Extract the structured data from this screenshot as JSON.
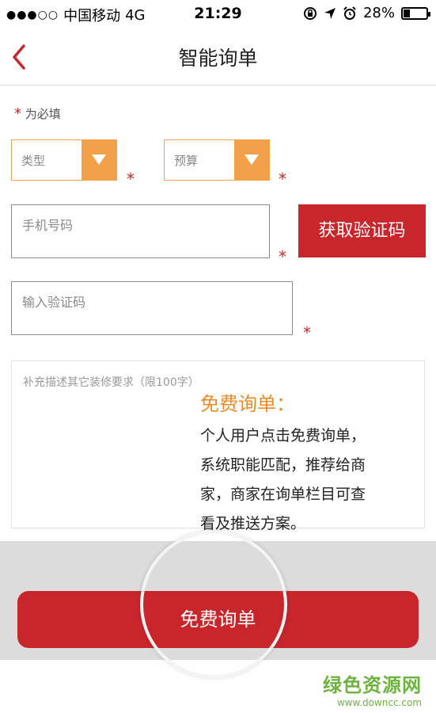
{
  "status_bar": {
    "carrier": "中国移动",
    "network": "4G",
    "time": "21:29",
    "battery": "28%",
    "battery_level": 0.28
  },
  "nav": {
    "back_icon": "chevron-left-icon",
    "title": "智能询单"
  },
  "form": {
    "required_note": "为必填",
    "required_mark": "*",
    "type_select": {
      "value": "类型",
      "icon": "triangle-down-icon"
    },
    "budget_select": {
      "value": "预算",
      "icon": "triangle-down-icon"
    },
    "phone_input": {
      "value": "",
      "placeholder": "手机号码"
    },
    "get_code_button": "获取验证码",
    "code_input": {
      "value": "",
      "placeholder": "输入验证码"
    },
    "description": {
      "value": "",
      "placeholder": "补充描述其它装修要求（限100字）"
    }
  },
  "tip": {
    "title": "免费询单：",
    "lines": [
      "个人用户点击免费询单，",
      "系统职能匹配，推荐给商",
      "家，商家在询单栏目可查",
      "看及推送方案。"
    ]
  },
  "submit_button": "免费询单",
  "watermark": {
    "main": "绿色资源网",
    "sub": "www.downcc.com"
  },
  "colors": {
    "accent_red": "#c9262b",
    "accent_orange": "#f3a04a",
    "tip_orange": "#ef8a24"
  }
}
